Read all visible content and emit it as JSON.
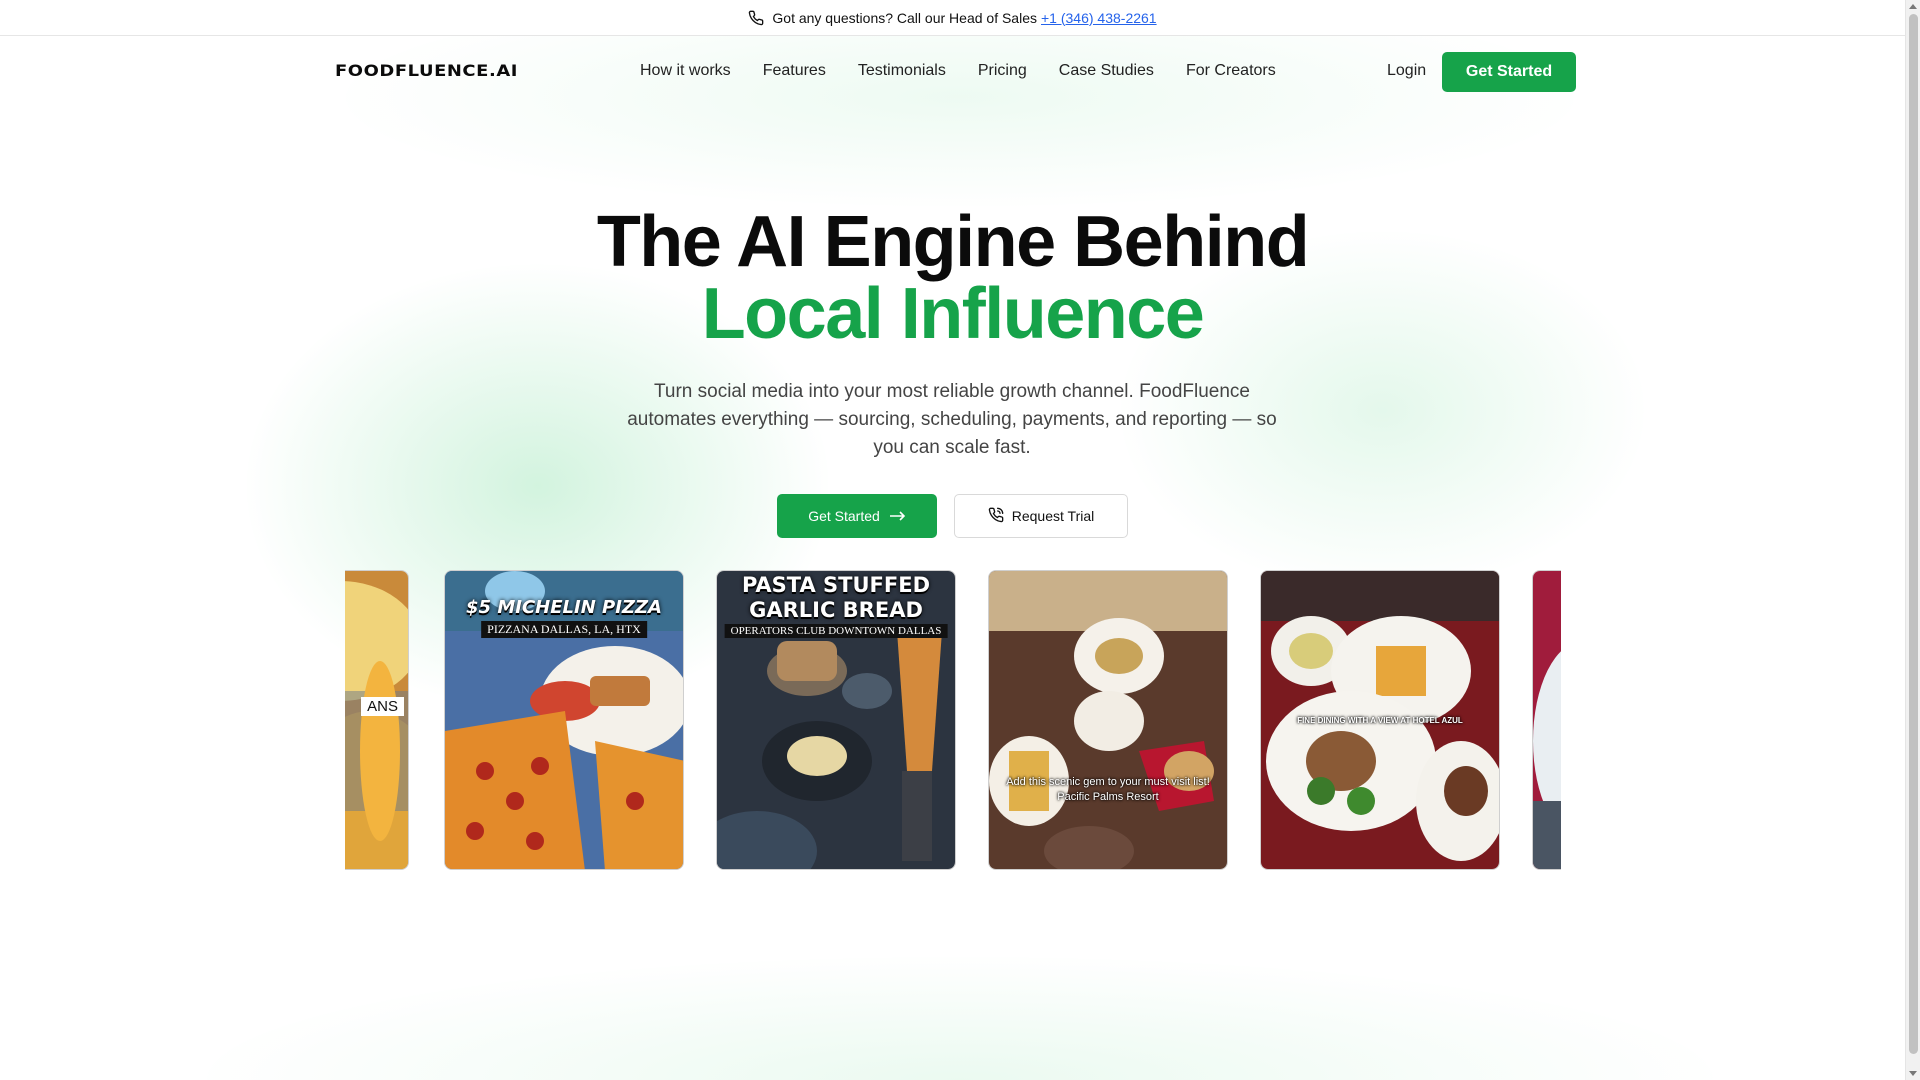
{
  "topbar": {
    "text": "Got any questions? Call our Head of Sales",
    "phone": "+1 (346) 438-2261",
    "icon": "phone-icon"
  },
  "header": {
    "logo": "FOODFLUENCE.AI",
    "nav": [
      "How it works",
      "Features",
      "Testimonials",
      "Pricing",
      "Case Studies",
      "For Creators"
    ],
    "login": "Login",
    "cta": "Get Started"
  },
  "hero": {
    "title_line1": "The AI Engine Behind",
    "title_line2": "Local Influence",
    "subtitle": "Turn social media into your most reliable growth channel. FoodFluence automates everything — sourcing, scheduling, payments, and reporting — so you can scale fast.",
    "primary_cta": "Get Started",
    "secondary_cta": "Request Trial"
  },
  "carousel": {
    "cards": [
      {
        "title": "",
        "subtitle": "ANS",
        "caption": ""
      },
      {
        "title": "$5 MICHELIN PIZZA",
        "subtitle": "PIZZANA DALLAS, LA, HTX",
        "caption": ""
      },
      {
        "title": "PASTA STUFFED GARLIC BREAD",
        "subtitle": "OPERATORS CLUB DOWNTOWN DALLAS",
        "caption": ""
      },
      {
        "title": "",
        "subtitle": "",
        "caption": "Add this scenic gem to your must visit list! Pacific Palms Resort"
      },
      {
        "title": "",
        "subtitle": "",
        "caption": "FINE DINING WITH A VIEW AT HOTEL AZUL"
      },
      {
        "title": "",
        "subtitle": "",
        "caption": ""
      }
    ]
  },
  "colors": {
    "brand_green": "#16a34a",
    "link_blue": "#2563eb"
  }
}
